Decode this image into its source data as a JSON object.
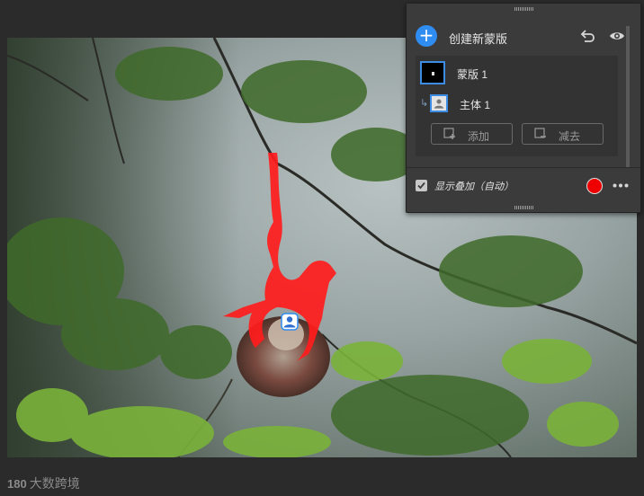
{
  "panel": {
    "create_label": "创建新蒙版",
    "add_icon": "plus-icon",
    "masks": [
      {
        "name": "蒙版 1",
        "thumbnail": "mask-thumbnail"
      }
    ],
    "components": [
      {
        "name": "主体 1",
        "icon": "person-icon"
      }
    ],
    "buttons": {
      "add": "添加",
      "subtract": "减去"
    },
    "footer": {
      "overlay_label": "显示叠加（自动）",
      "overlay_checked": true,
      "overlay_color": "#ee0000"
    }
  },
  "watermark": {
    "logo": "180",
    "text": "大数跨境"
  },
  "colors": {
    "accent": "#2f8cf0",
    "overlay": "#ee0000",
    "panel_bg": "#3b3b3b"
  }
}
